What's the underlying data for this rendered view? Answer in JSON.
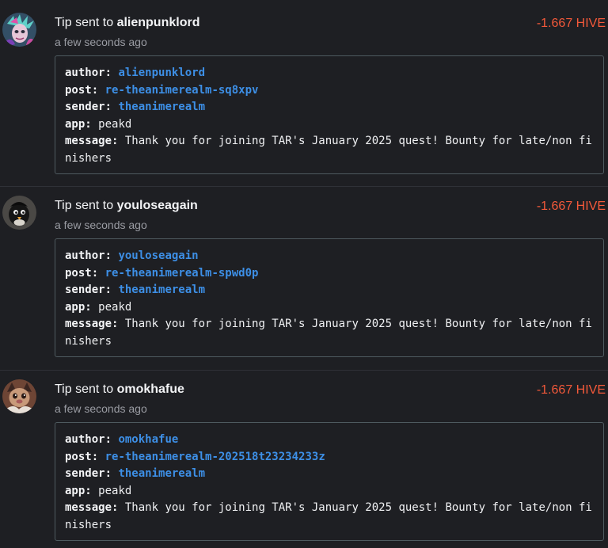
{
  "colors": {
    "background": "#1e1f23",
    "amount": "#f4593a",
    "link": "#3d8fe6",
    "box_border": "#4e5a5f",
    "muted": "#9a9ca3"
  },
  "entries": [
    {
      "title_prefix": "Tip sent to ",
      "recipient": "alienpunklord",
      "amount": "-1.667 HIVE",
      "time": "a few seconds ago",
      "author_key": "author:",
      "author": "alienpunklord",
      "post_key": "post:",
      "post": "re-theanimerealm-sq8xpv",
      "sender_key": "sender:",
      "sender": "theanimerealm",
      "app_key": "app:",
      "app": "peakd",
      "message_key": "message:",
      "message": "Thank you for joining TAR's January 2025 quest! Bounty for late/non finishers"
    },
    {
      "title_prefix": "Tip sent to ",
      "recipient": "youloseagain",
      "amount": "-1.667 HIVE",
      "time": "a few seconds ago",
      "author_key": "author:",
      "author": "youloseagain",
      "post_key": "post:",
      "post": "re-theanimerealm-spwd0p",
      "sender_key": "sender:",
      "sender": "theanimerealm",
      "app_key": "app:",
      "app": "peakd",
      "message_key": "message:",
      "message": "Thank you for joining TAR's January 2025 quest! Bounty for late/non finishers"
    },
    {
      "title_prefix": "Tip sent to ",
      "recipient": "omokhafue",
      "amount": "-1.667 HIVE",
      "time": "a few seconds ago",
      "author_key": "author:",
      "author": "omokhafue",
      "post_key": "post:",
      "post": "re-theanimerealm-202518t23234233z",
      "sender_key": "sender:",
      "sender": "theanimerealm",
      "app_key": "app:",
      "app": "peakd",
      "message_key": "message:",
      "message": "Thank you for joining TAR's January 2025 quest! Bounty for late/non finishers"
    }
  ]
}
